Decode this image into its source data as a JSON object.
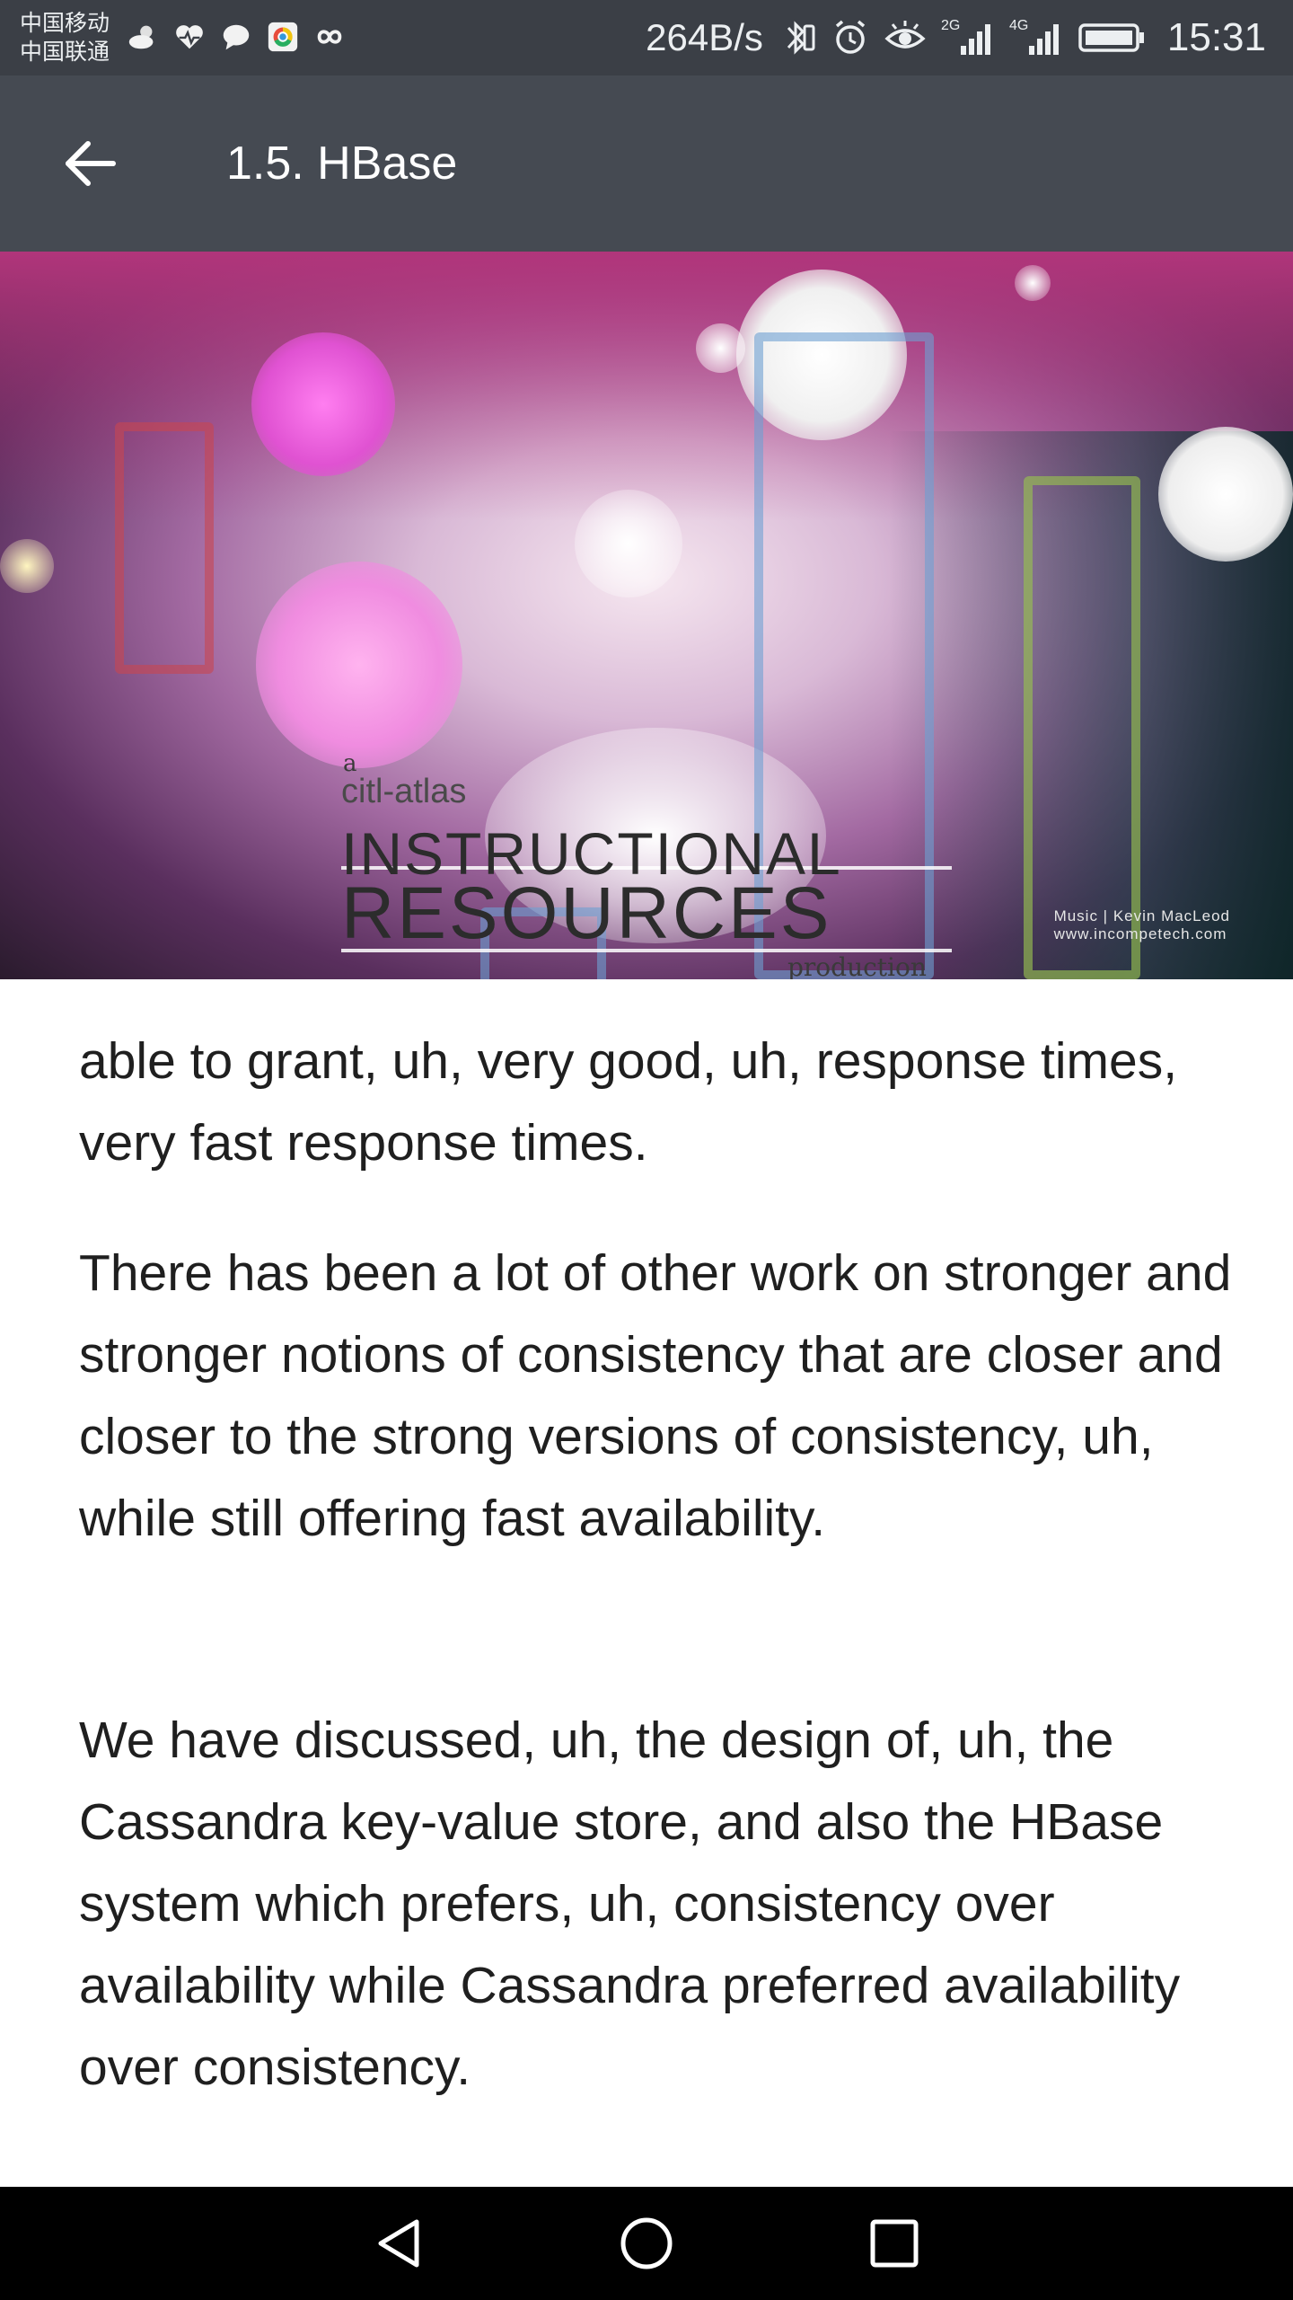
{
  "status_bar": {
    "carrier_1": "中国移动",
    "carrier_2": "中国联通",
    "net_speed": "264B/s",
    "signal_1_label": "2G",
    "signal_2_label": "4G",
    "time": "15:31"
  },
  "app_bar": {
    "title": "1.5. HBase"
  },
  "video": {
    "line_a": "a",
    "line_org": "citl-atlas",
    "line_1": "INSTRUCTIONAL",
    "line_2": "RESOURCES",
    "line_prod": "production",
    "credit_1": "Music | Kevin MacLeod",
    "credit_2": "www.incompetech.com"
  },
  "transcript": {
    "paragraphs": [
      "able to grant, uh, very good, uh, response times, very fast response times.",
      "There has been a lot of other work on stronger and stronger notions of consistency that are closer and closer to the strong versions of consistency, uh, while still offering fast availability.",
      "We have discussed, uh, the design of, uh, the Cassandra key-value store, and also the HBase system which prefers, uh, consistency over availability while Cassandra preferred availability over consistency."
    ]
  },
  "colors": {
    "status_bar_bg": "#3b3f46",
    "app_bar_bg": "#454a52",
    "nav_bar_bg": "#000000",
    "text": "#1f1f1f"
  }
}
